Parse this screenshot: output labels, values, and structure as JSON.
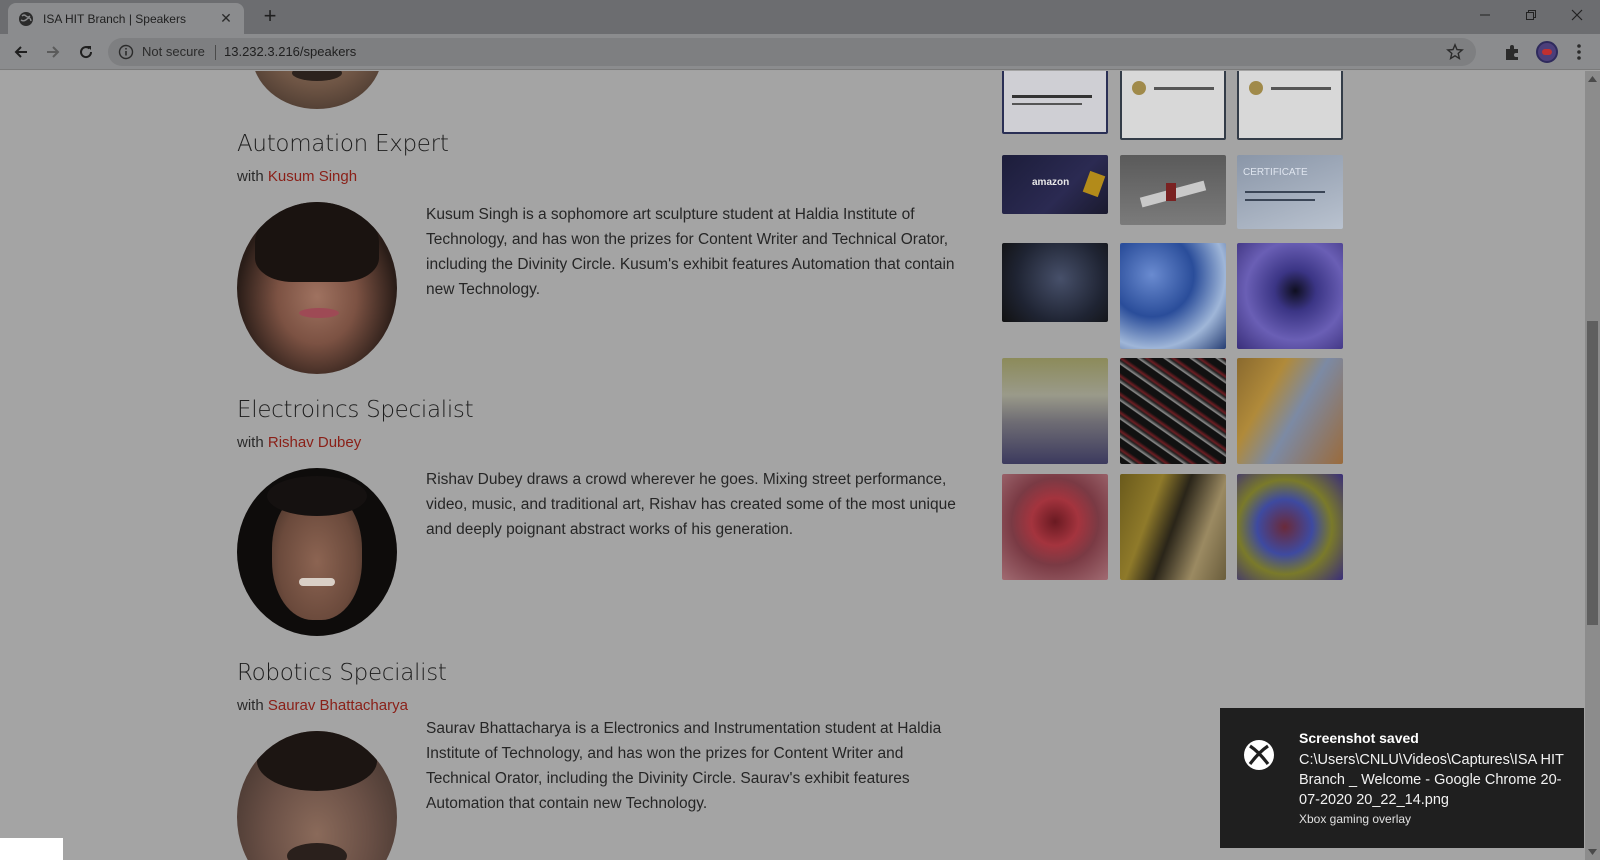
{
  "browser": {
    "tab_title": "ISA HIT Branch | Speakers",
    "security_label": "Not secure",
    "url": "13.232.3.216/speakers"
  },
  "speakers": [
    {
      "title": "Automation Expert",
      "with_label": "with",
      "name": "Kusum Singh",
      "bio": "Kusum Singh is a sophomore art sculpture student at Haldia Institute of Technology, and has won the prizes for Content Writer and Technical Orator, including the Divinity Circle. Kusum's exhibit features Automation that contain new Technology."
    },
    {
      "title": "Electroincs Specialist",
      "with_label": "with",
      "name": "Rishav Dubey",
      "bio": "Rishav Dubey draws a crowd wherever he goes. Mixing street performance, video, music, and traditional art, Rishav has created some of the most unique and deeply poignant abstract works of his generation."
    },
    {
      "title": "Robotics Specialist",
      "with_label": "with",
      "name": "Saurav Bhattacharya",
      "bio": "Saurav Bhattacharya is a Electronics and Instrumentation student at Haldia Institute of Technology, and has won the prizes for Content Writer and Technical Orator, including the Divinity Circle. Saurav's exhibit features Automation that contain new Technology."
    }
  ],
  "gallery": {
    "certificate_text": "CERTIFICATE",
    "banner_text": "amazon"
  },
  "toast": {
    "title": "Screenshot saved",
    "body": "C:\\Users\\CNLU\\Videos\\Captures\\ISA HIT Branch _ Welcome - Google Chrome 20-07-2020 20_22_14.png",
    "source": "Xbox gaming overlay"
  }
}
